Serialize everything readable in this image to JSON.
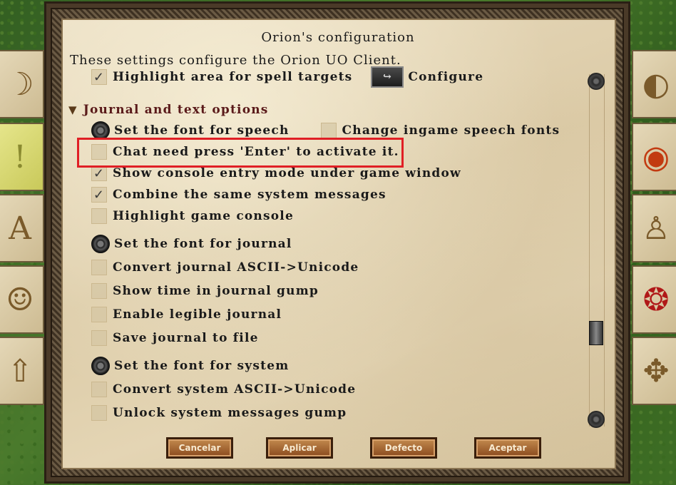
{
  "dialog": {
    "title": "Orion's configuration",
    "subtitle": "These settings configure the Orion UO Client."
  },
  "top": {
    "highlight_spell_label": "Highlight area for spell targets",
    "configure_label": "Configure"
  },
  "section": {
    "title": "Journal and text options"
  },
  "speech_font_label": "Set the font for speech",
  "change_speech_fonts_label": "Change ingame speech fonts",
  "options": [
    {
      "label": "Chat need press 'Enter' to activate it.",
      "checked": false,
      "mark": ""
    },
    {
      "label": "Show console entry mode under game window",
      "checked": true,
      "mark": "✓"
    },
    {
      "label": "Combine the same system messages",
      "checked": true,
      "mark": "✓"
    },
    {
      "label": "Highlight game console",
      "checked": false,
      "mark": ""
    }
  ],
  "journal_font_label": "Set the font for journal",
  "journal_options": [
    {
      "label": "Convert journal ASCII->Unicode",
      "checked": false
    },
    {
      "label": "Show time in journal gump",
      "checked": false
    },
    {
      "label": "Enable legible journal",
      "checked": false
    },
    {
      "label": "Save journal to file",
      "checked": false
    }
  ],
  "system_font_label": "Set the font for system",
  "system_options": [
    {
      "label": "Convert system ASCII->Unicode",
      "checked": false
    },
    {
      "label": "Unlock system messages gump",
      "checked": false
    }
  ],
  "buttons": {
    "cancel": "Cancelar",
    "apply": "Aplicar",
    "default": "Defecto",
    "accept": "Aceptar"
  },
  "highlight_spell_mark": "✓"
}
